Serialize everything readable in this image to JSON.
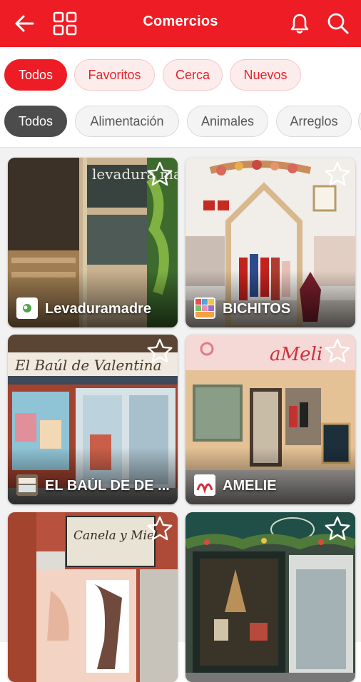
{
  "header": {
    "title": "Comercios",
    "bg_color": "#ee1c24",
    "icons": [
      "back-arrow-icon",
      "grid-icon",
      "bell-icon",
      "search-icon"
    ]
  },
  "filters_main": {
    "chips": [
      {
        "label": "Todos",
        "active": true
      },
      {
        "label": "Favoritos",
        "active": false
      },
      {
        "label": "Cerca",
        "active": false
      },
      {
        "label": "Nuevos",
        "active": false
      }
    ]
  },
  "filters_category": {
    "chips": [
      {
        "label": "Todos",
        "active": true
      },
      {
        "label": "Alimentación",
        "active": false
      },
      {
        "label": "Animales",
        "active": false
      },
      {
        "label": "Arreglos",
        "active": false
      }
    ]
  },
  "shops": [
    {
      "name": "Levaduramadre",
      "sign": "levadura madre",
      "favorite": false
    },
    {
      "name": "BICHITOS",
      "sign": "",
      "favorite": false
    },
    {
      "name": "EL BAÚL DE DE ...",
      "sign": "El Baúl de Valentina",
      "favorite": false
    },
    {
      "name": "AMELIE",
      "sign": "aMeli",
      "favorite": false
    },
    {
      "name": "",
      "sign": "Canela y Miel",
      "favorite": false
    },
    {
      "name": "",
      "sign": "",
      "favorite": false
    }
  ],
  "colors": {
    "accent": "#ee1c24",
    "chip_inactive_bg": "#fdecec",
    "category_active_bg": "#4c4c4c"
  }
}
